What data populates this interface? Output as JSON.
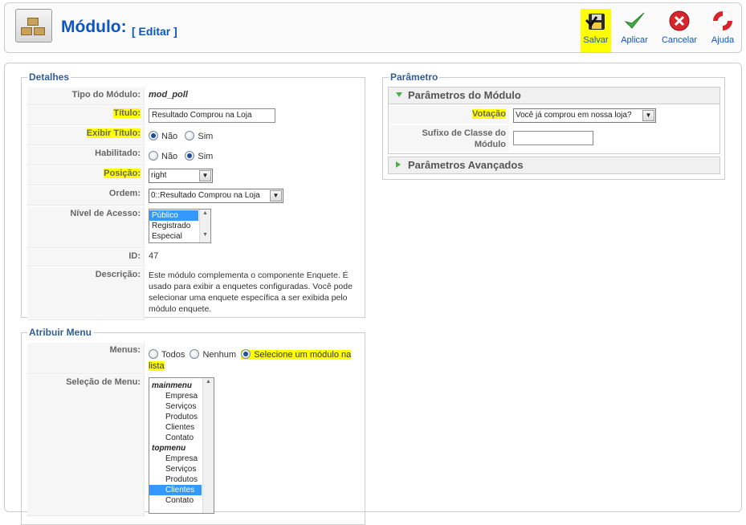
{
  "header": {
    "title": "Módulo:",
    "subtitle": "[ Editar ]",
    "buttons": [
      {
        "label": "Salvar",
        "icon": "save-icon"
      },
      {
        "label": "Aplicar",
        "icon": "apply-check-icon"
      },
      {
        "label": "Cancelar",
        "icon": "cancel-icon"
      },
      {
        "label": "Ajuda",
        "icon": "help-lifebuoy-icon"
      }
    ]
  },
  "details": {
    "legend": "Detalhes",
    "tipo_label": "Tipo do Módulo:",
    "tipo_value": "mod_poll",
    "titulo_label": "Título:",
    "titulo_value": "Resultado Comprou na Loja",
    "exibir_label": "Exibir Título:",
    "exibir_no": "Não",
    "exibir_yes": "Sim",
    "habilitado_label": "Habilitado:",
    "habilitado_no": "Não",
    "habilitado_yes": "Sim",
    "posicao_label": "Posição:",
    "posicao_value": "right",
    "ordem_label": "Ordem:",
    "ordem_value": "0::Resultado Comprou na Loja",
    "acesso_label": "Nível de Acesso:",
    "acesso_options": [
      "Público",
      "Registrado",
      "Especial"
    ],
    "id_label": "ID:",
    "id_value": "47",
    "descricao_label": "Descrição:",
    "descricao_value": "Este módulo complementa o componente Enquete. É usado para exibir a enquetes configuradas. Você pode selecionar uma enquete específica a ser exibida pelo módulo enquete."
  },
  "menu_assign": {
    "legend": "Atribuir Menu",
    "menus_label": "Menus:",
    "opt_all": "Todos",
    "opt_none": "Nenhum",
    "opt_select": "Selecione um módulo na",
    "opt_select_cont": "lista",
    "selecao_label": "Seleção de Menu:",
    "list": [
      {
        "text": "mainmenu",
        "type": "group"
      },
      {
        "text": "Empresa",
        "type": "item"
      },
      {
        "text": "Serviços",
        "type": "item"
      },
      {
        "text": "Produtos",
        "type": "item"
      },
      {
        "text": "Clientes",
        "type": "item"
      },
      {
        "text": "Contato",
        "type": "item"
      },
      {
        "text": "topmenu",
        "type": "group"
      },
      {
        "text": "Empresa",
        "type": "item"
      },
      {
        "text": "Serviços",
        "type": "item"
      },
      {
        "text": "Produtos",
        "type": "item"
      },
      {
        "text": "Clientes",
        "type": "item",
        "selected": true
      },
      {
        "text": "Contato",
        "type": "item"
      }
    ]
  },
  "params": {
    "legend": "Parâmetro",
    "module_params_title": "Parâmetros do Módulo",
    "votacao_label": "Votação",
    "votacao_value": "Você já comprou em nossa loja?",
    "sufixo_label_1": "Sufixo de Classe do",
    "sufixo_label_2": "Módulo",
    "sufixo_value": "",
    "advanced_title": "Parâmetros Avançados"
  },
  "colors": {
    "highlight": "#ffff00",
    "title_blue": "#0b55c4",
    "legend_blue": "#335f96"
  }
}
